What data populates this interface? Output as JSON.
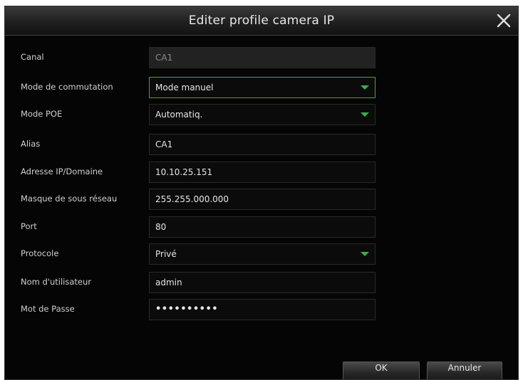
{
  "dialog": {
    "title": "Editer profile camera IP"
  },
  "form": {
    "channel": {
      "label": "Canal",
      "value": "CA1"
    },
    "switch_mode": {
      "label": "Mode de commutation",
      "value": "Mode manuel"
    },
    "poe_mode": {
      "label": "Mode POE",
      "value": "Automatiq."
    },
    "alias": {
      "label": "Alias",
      "value": "CA1"
    },
    "ip_address": {
      "label": "Adresse IP/Domaine",
      "value": "10.10.25.151"
    },
    "subnet_mask": {
      "label": "Masque de sous réseau",
      "value": "255.255.000.000"
    },
    "port": {
      "label": "Port",
      "value": "80"
    },
    "protocol": {
      "label": "Protocole",
      "value": "Privé"
    },
    "username": {
      "label": "Nom d'utilisateur",
      "value": "admin"
    },
    "password": {
      "label": "Mot de Passe",
      "value": "••••••••••"
    }
  },
  "buttons": {
    "ok_label": "OK",
    "cancel_label": "Annuler"
  },
  "colors": {
    "accent_green": "#3fae4a",
    "background": "#050505"
  },
  "icons": {
    "close": "close-icon",
    "dropdown": "dropdown-arrow-icon"
  }
}
